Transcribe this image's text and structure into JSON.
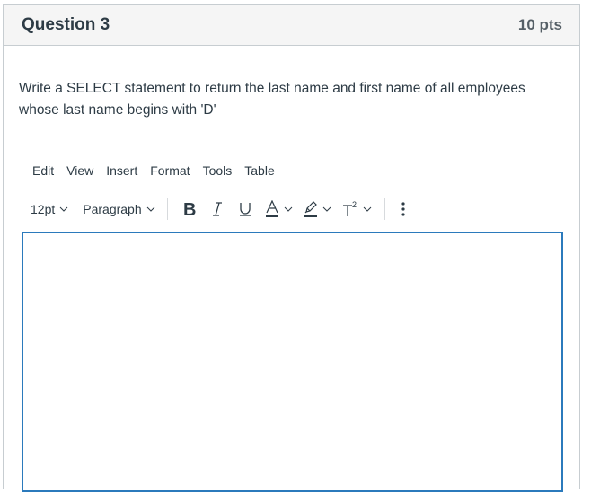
{
  "question": {
    "title": "Question 3",
    "points": "10 pts",
    "text": "Write a SELECT statement to return the last name and first name of all employees whose last name begins with 'D'"
  },
  "editor": {
    "menu": [
      "Edit",
      "View",
      "Insert",
      "Format",
      "Tools",
      "Table"
    ],
    "toolbar": {
      "font_size": "12pt",
      "block_format": "Paragraph",
      "bold_icon": "bold-icon",
      "italic_icon": "italic-icon",
      "underline_icon": "underline-icon",
      "text_color_icon": "text-color-icon",
      "highlight_icon": "highlight-icon",
      "superscript_icon": "superscript-icon",
      "more_icon": "more-vertical-icon"
    },
    "content": "",
    "accent_color": "#2b7abc"
  }
}
